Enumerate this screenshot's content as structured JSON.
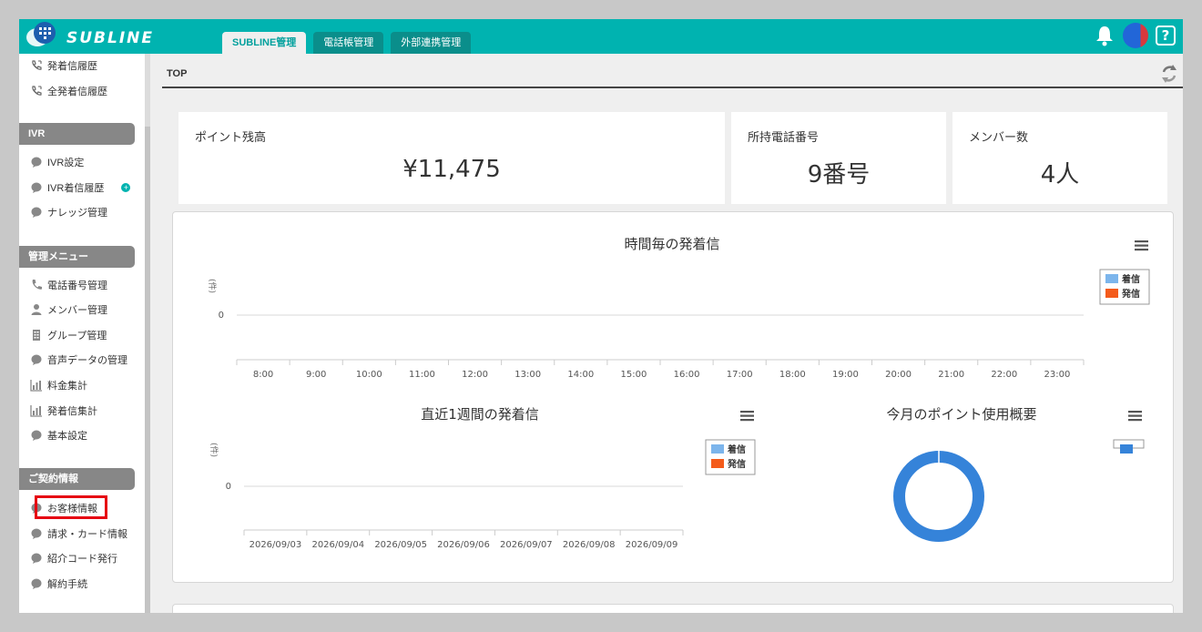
{
  "header": {
    "logo_text": "SUBLINE",
    "tabs": [
      {
        "label": "SUBLINE管理",
        "active": true
      },
      {
        "label": "電話帳管理",
        "active": false
      },
      {
        "label": "外部連携管理",
        "active": false
      }
    ],
    "help_label": "?"
  },
  "sidebar": {
    "top_items": [
      "発着信履歴",
      "全発着信履歴"
    ],
    "ivr": {
      "title": "IVR",
      "items": [
        "IVR設定",
        "IVR着信履歴",
        "ナレッジ管理"
      ]
    },
    "admin": {
      "title": "管理メニュー",
      "items": [
        "電話番号管理",
        "メンバー管理",
        "グループ管理",
        "音声データの管理",
        "料金集計",
        "発着信集計",
        "基本設定"
      ]
    },
    "contract": {
      "title": "ご契約情報",
      "items": [
        "お客様情報",
        "請求・カード情報",
        "紹介コード発行",
        "解約手続"
      ]
    }
  },
  "main": {
    "title": "TOP",
    "cards": [
      {
        "label": "ポイント残高",
        "value": "¥11,475"
      },
      {
        "label": "所持電話番号",
        "value": "9番号"
      },
      {
        "label": "メンバー数",
        "value": "4人"
      }
    ]
  },
  "colors": {
    "brand": "#00b3b0",
    "incoming": "#7cb5ec",
    "outgoing": "#f45b1b",
    "donut": "#3583d9",
    "highlight": "#e60012"
  },
  "chart_data": [
    {
      "type": "line",
      "title": "時間毎の発着信",
      "ylabel": "(件)",
      "categories": [
        "8:00",
        "9:00",
        "10:00",
        "11:00",
        "12:00",
        "13:00",
        "14:00",
        "15:00",
        "16:00",
        "17:00",
        "18:00",
        "19:00",
        "20:00",
        "21:00",
        "22:00",
        "23:00"
      ],
      "yticks": [
        "0"
      ],
      "series": [
        {
          "name": "着信",
          "values": [
            0,
            0,
            0,
            0,
            0,
            0,
            0,
            0,
            0,
            0,
            0,
            0,
            0,
            0,
            0,
            0
          ]
        },
        {
          "name": "発信",
          "values": [
            0,
            0,
            0,
            0,
            0,
            0,
            0,
            0,
            0,
            0,
            0,
            0,
            0,
            0,
            0,
            0
          ]
        }
      ],
      "legend": "right"
    },
    {
      "type": "line",
      "title": "直近1週間の発着信",
      "ylabel": "(件)",
      "categories": [
        "2026/09/03",
        "2026/09/04",
        "2026/09/05",
        "2026/09/06",
        "2026/09/07",
        "2026/09/08",
        "2026/09/09"
      ],
      "yticks": [
        "0"
      ],
      "series": [
        {
          "name": "着信",
          "values": [
            0,
            0,
            0,
            0,
            0,
            0,
            0
          ]
        },
        {
          "name": "発信",
          "values": [
            0,
            0,
            0,
            0,
            0,
            0,
            0
          ]
        }
      ],
      "legend": "right"
    },
    {
      "type": "pie",
      "title": "今月のポイント使用概要",
      "slices": [
        {
          "value": 100
        }
      ],
      "legend": "top-right"
    }
  ]
}
